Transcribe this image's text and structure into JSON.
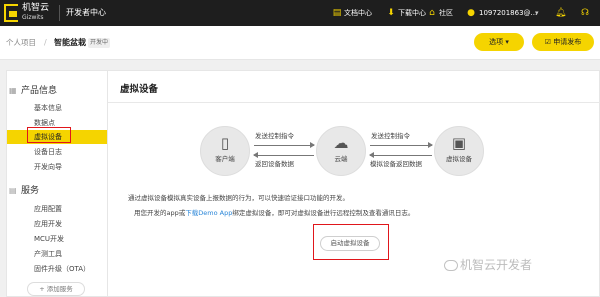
{
  "topbar": {
    "logo_cn": "机智云",
    "logo_en": "Gizwits",
    "center_title": "开发者中心",
    "links": [
      {
        "label": "文档中心",
        "icon": "document-icon"
      },
      {
        "label": "下载中心",
        "icon": "download-icon"
      },
      {
        "label": "社区",
        "icon": "community-icon"
      }
    ],
    "user": "1097201863@...",
    "dropdown_icon": "▾",
    "icons": [
      "bell-icon",
      "headset-icon"
    ]
  },
  "subheader": {
    "breadcrumb_parent": "个人项目",
    "breadcrumb_sep": "/",
    "breadcrumb_current": "智能盆栽",
    "status_badge": "开发中",
    "select_button": "选项 ▾",
    "publish_button": "申请发布"
  },
  "sidebar": {
    "section_product": "产品信息",
    "product_items": [
      "基本信息",
      "数据点",
      "虚拟设备",
      "设备日志",
      "开发向导"
    ],
    "active_index": 2,
    "section_service": "服务",
    "service_items": [
      "应用配置",
      "应用开发",
      "MCU开发",
      "产测工具",
      "固件升级（OTA）"
    ],
    "add_service": "+ 添加服务"
  },
  "main": {
    "title": "虚拟设备",
    "nodes": {
      "client": "客户端",
      "cloud": "云端",
      "device": "虚拟设备"
    },
    "flow": {
      "send_cmd_1": "发送控制指令",
      "return_data_1": "返回设备数据",
      "send_cmd_2": "发送控制指令",
      "return_data_2": "模拟设备返回数据"
    },
    "desc_line1": "通过虚拟设备模拟真实设备上报数据的行为，可以快速验证接口功能的开发。",
    "desc_line2_prefix": "用您开发的app或",
    "desc_line2_link": "下载Demo App",
    "desc_line2_suffix": "绑定虚拟设备，即可对虚拟设备进行远程控制及查看通讯日志。",
    "start_button": "启动虚拟设备"
  },
  "watermark": "机智云开发者",
  "colors": {
    "brand_yellow": "#f5d400",
    "nav_dark": "#1e1e1e",
    "highlight_red": "#e0161b",
    "link_blue": "#2a86d8"
  }
}
